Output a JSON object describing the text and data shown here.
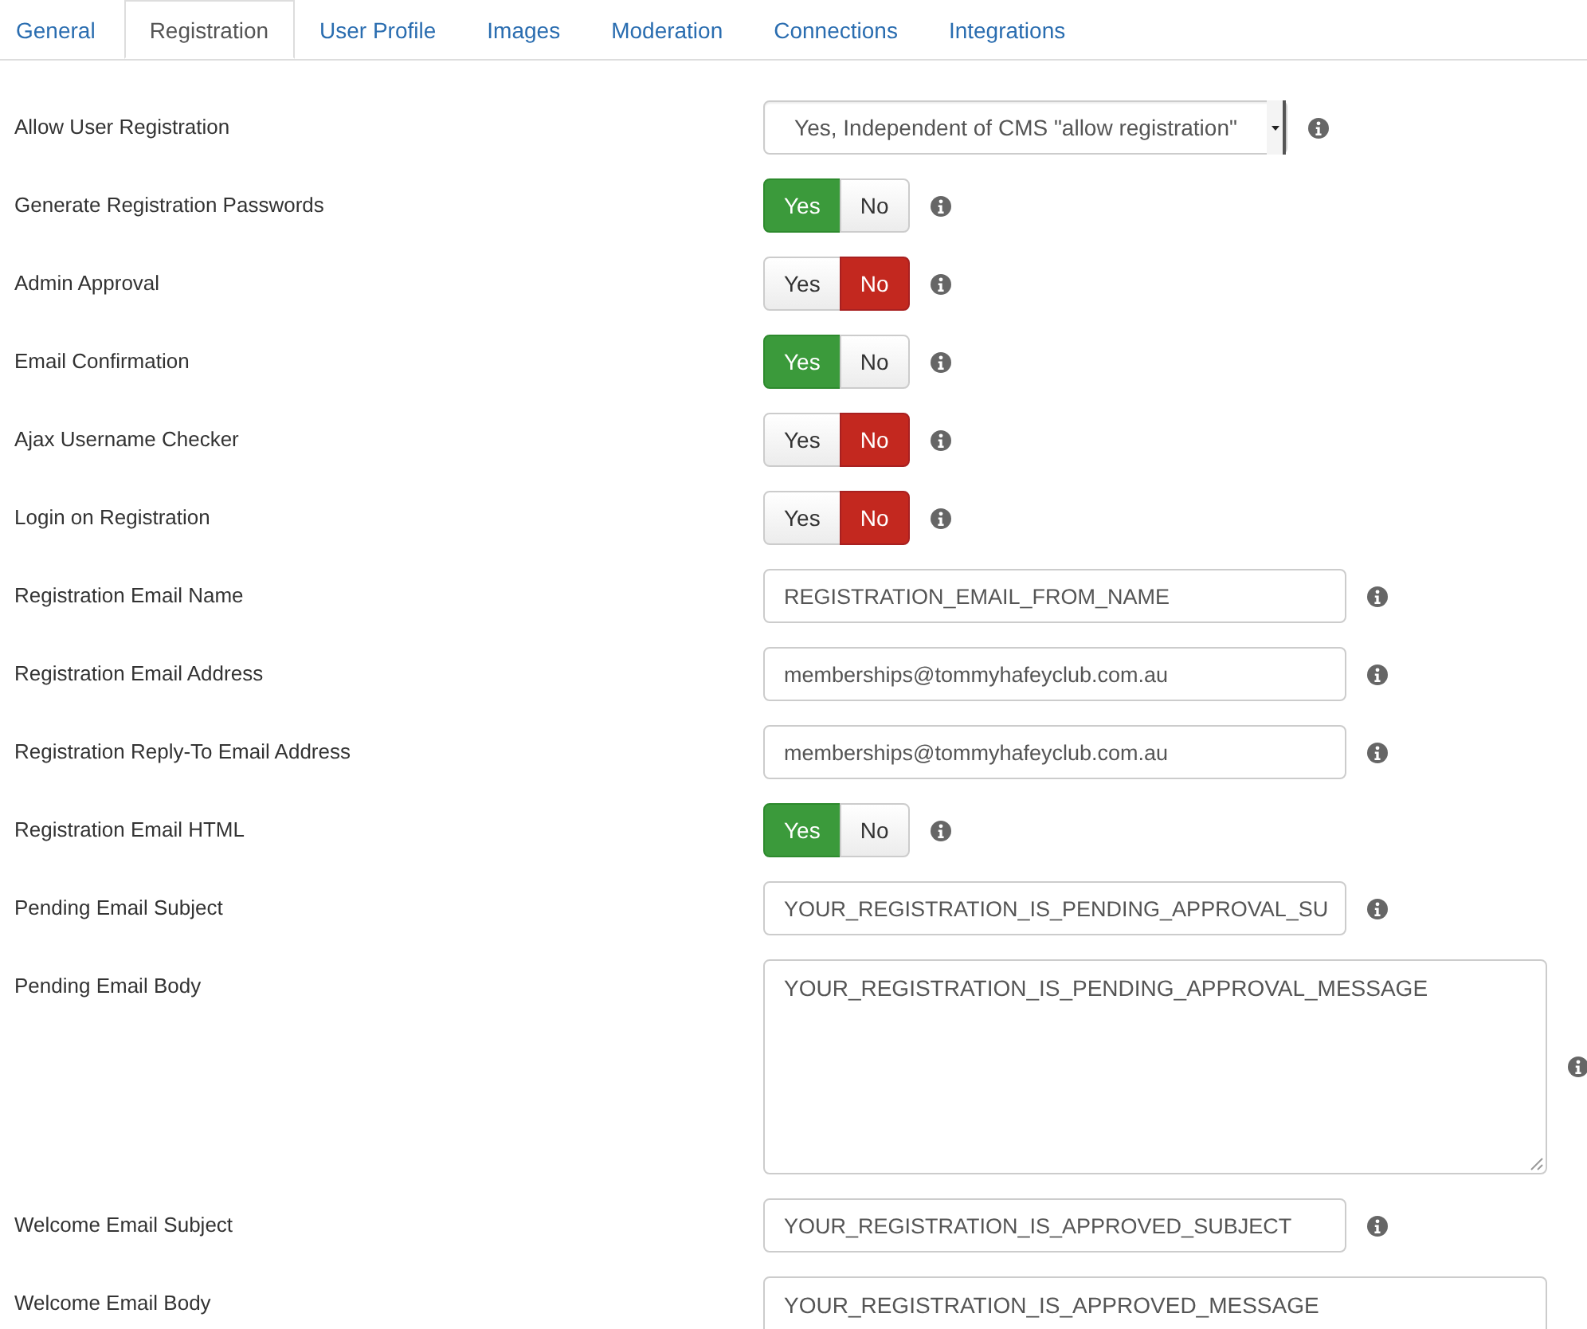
{
  "tabs": [
    {
      "label": "General",
      "selected": false
    },
    {
      "label": "Registration",
      "selected": true
    },
    {
      "label": "User Profile",
      "selected": false
    },
    {
      "label": "Images",
      "selected": false
    },
    {
      "label": "Moderation",
      "selected": false
    },
    {
      "label": "Connections",
      "selected": false
    },
    {
      "label": "Integrations",
      "selected": false
    }
  ],
  "rows": [
    {
      "kind": "select",
      "label": "Allow User Registration",
      "value": "Yes, Independent of CMS \"allow registration\"",
      "info": true
    },
    {
      "kind": "toggle",
      "label": "Generate Registration Passwords",
      "options": [
        {
          "label": "Yes",
          "selected": true
        },
        {
          "label": "No",
          "selected": false
        }
      ],
      "info": true
    },
    {
      "kind": "toggle",
      "label": "Admin Approval",
      "options": [
        {
          "label": "Yes",
          "selected": false
        },
        {
          "label": "No",
          "selected": true
        }
      ],
      "info": true
    },
    {
      "kind": "toggle",
      "label": "Email Confirmation",
      "options": [
        {
          "label": "Yes",
          "selected": true
        },
        {
          "label": "No",
          "selected": false
        }
      ],
      "info": true
    },
    {
      "kind": "toggle",
      "label": "Ajax Username Checker",
      "options": [
        {
          "label": "Yes",
          "selected": false
        },
        {
          "label": "No",
          "selected": true
        }
      ],
      "info": true
    },
    {
      "kind": "toggle",
      "label": "Login on Registration",
      "options": [
        {
          "label": "Yes",
          "selected": false
        },
        {
          "label": "No",
          "selected": true
        }
      ],
      "info": true
    },
    {
      "kind": "text",
      "label": "Registration Email Name",
      "value": "REGISTRATION_EMAIL_FROM_NAME",
      "info": true
    },
    {
      "kind": "text",
      "label": "Registration Email Address",
      "value": "memberships@tommyhafeyclub.com.au",
      "info": true
    },
    {
      "kind": "text",
      "label": "Registration Reply-To Email Address",
      "value": "memberships@tommyhafeyclub.com.au",
      "info": true
    },
    {
      "kind": "toggle",
      "label": "Registration Email HTML",
      "options": [
        {
          "label": "Yes",
          "selected": true
        },
        {
          "label": "No",
          "selected": false
        }
      ],
      "info": true
    },
    {
      "kind": "text",
      "label": "Pending Email Subject",
      "value": "YOUR_REGISTRATION_IS_PENDING_APPROVAL_SU",
      "info": true
    },
    {
      "kind": "textarea",
      "label": "Pending Email Body",
      "value": "YOUR_REGISTRATION_IS_PENDING_APPROVAL_MESSAGE",
      "info": true,
      "resize_grip": true
    },
    {
      "kind": "text",
      "label": "Welcome Email Subject",
      "value": "YOUR_REGISTRATION_IS_APPROVED_SUBJECT",
      "info": true
    },
    {
      "kind": "textarea",
      "label": "Welcome Email Body",
      "value": "YOUR_REGISTRATION_IS_APPROVED_MESSAGE",
      "info": false
    }
  ]
}
